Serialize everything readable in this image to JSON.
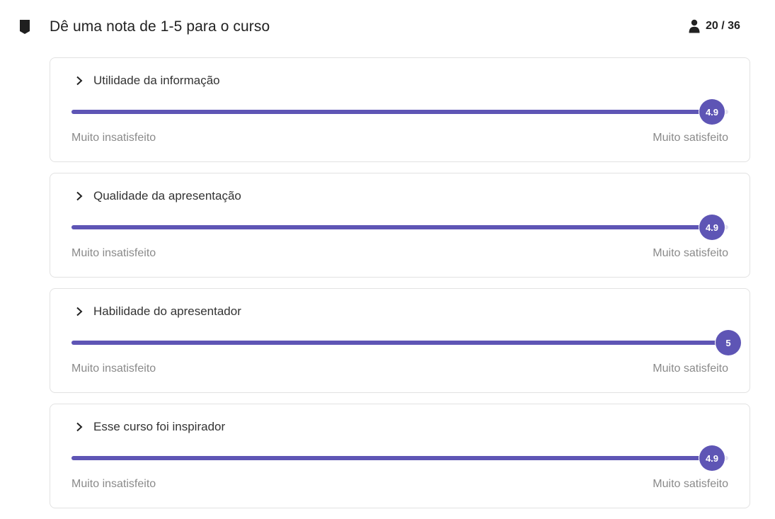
{
  "header": {
    "title": "Dê uma nota de 1-5 para o curso",
    "icon": "bookmark-icon",
    "counter": {
      "icon": "user-icon",
      "text": "20 / 36"
    }
  },
  "scale": {
    "min": 1,
    "max": 5
  },
  "colors": {
    "accent": "#5e55b5",
    "muted_text": "#8a8a8a",
    "border": "#e2e2e2"
  },
  "ratings": [
    {
      "label": "Utilidade da informação",
      "value": 4.9,
      "display": "4.9",
      "min_label": "Muito insatisfeito",
      "max_label": "Muito satisfeito"
    },
    {
      "label": "Qualidade da apresentação",
      "value": 4.9,
      "display": "4.9",
      "min_label": "Muito insatisfeito",
      "max_label": "Muito satisfeito"
    },
    {
      "label": "Habilidade do apresentador",
      "value": 5,
      "display": "5",
      "min_label": "Muito insatisfeito",
      "max_label": "Muito satisfeito"
    },
    {
      "label": "Esse curso foi inspirador",
      "value": 4.9,
      "display": "4.9",
      "min_label": "Muito insatisfeito",
      "max_label": "Muito satisfeito"
    }
  ]
}
